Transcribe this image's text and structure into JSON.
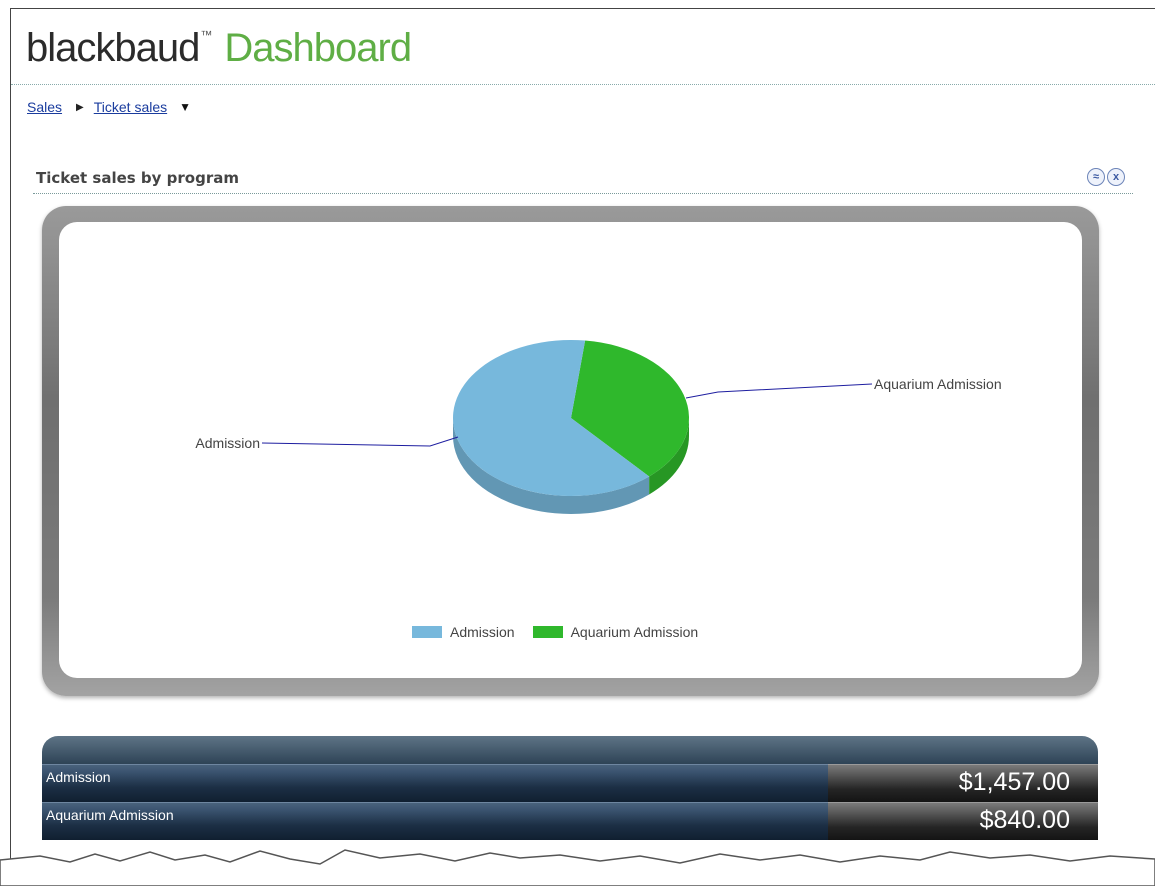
{
  "header": {
    "brand": "blackbaud",
    "brand_tm": "™",
    "title": "Dashboard"
  },
  "breadcrumb": {
    "items": [
      "Sales",
      "Ticket sales"
    ],
    "separator_icon": "triangle-right-icon",
    "dropdown_icon": "triangle-down-icon"
  },
  "panel": {
    "title": "Ticket sales by program",
    "collapse_icon": "double-chevron-up-icon",
    "close_icon": "close-icon",
    "collapse_glyph": "≈",
    "close_glyph": "x"
  },
  "chart_data": {
    "type": "pie",
    "title": "",
    "labels": [
      "Admission",
      "Aquarium Admission"
    ],
    "values": [
      1457.0,
      840.0
    ],
    "colors": [
      "#77b8dc",
      "#2fb82c"
    ],
    "legend": {
      "position": "bottom",
      "entries": [
        "Admission",
        "Aquarium Admission"
      ]
    },
    "three_d": true
  },
  "table": {
    "rows": [
      {
        "label": "Admission",
        "value": "$1,457.00"
      },
      {
        "label": "Aquarium Admission",
        "value": "$840.00"
      }
    ]
  }
}
